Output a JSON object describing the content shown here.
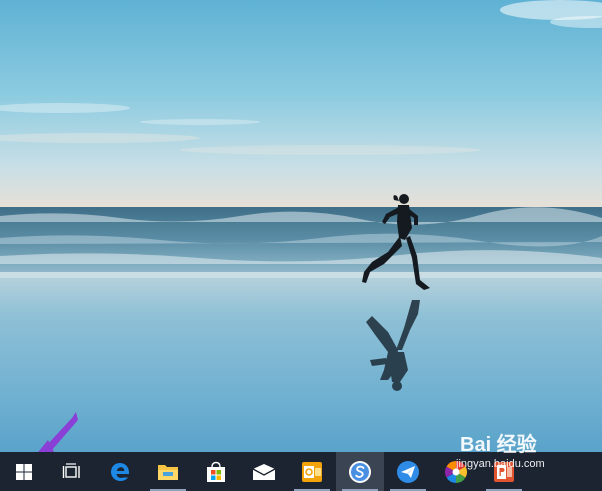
{
  "desktop": {
    "wallpaper": "beach-runner-wallpaper"
  },
  "taskbar": {
    "background": "#1b2430",
    "buttons": [
      {
        "name": "start-button",
        "icon": "windows-logo-icon",
        "running": false,
        "active": false
      },
      {
        "name": "task-view-button",
        "icon": "task-view-icon",
        "running": false,
        "active": false
      },
      {
        "name": "edge-button",
        "icon": "edge-icon",
        "running": false,
        "active": false
      },
      {
        "name": "file-explorer-button",
        "icon": "folder-icon",
        "running": true,
        "active": false
      },
      {
        "name": "store-button",
        "icon": "store-bag-icon",
        "running": false,
        "active": false
      },
      {
        "name": "mail-button",
        "icon": "mail-icon",
        "running": false,
        "active": false
      },
      {
        "name": "outlook-button",
        "icon": "outlook-icon",
        "running": true,
        "active": false
      },
      {
        "name": "sogou-button",
        "icon": "sogou-icon",
        "running": true,
        "active": true
      },
      {
        "name": "feishu-button",
        "icon": "paper-plane-icon",
        "running": true,
        "active": false
      },
      {
        "name": "color-wheel-button",
        "icon": "color-wheel-icon",
        "running": false,
        "active": false
      },
      {
        "name": "powerpoint-button",
        "icon": "powerpoint-icon",
        "running": true,
        "active": false
      }
    ]
  },
  "annotation": {
    "arrow_color": "#8a3fd6"
  },
  "watermark": {
    "brand": "Bai 经验",
    "url": "jingyan.baidu.com"
  }
}
